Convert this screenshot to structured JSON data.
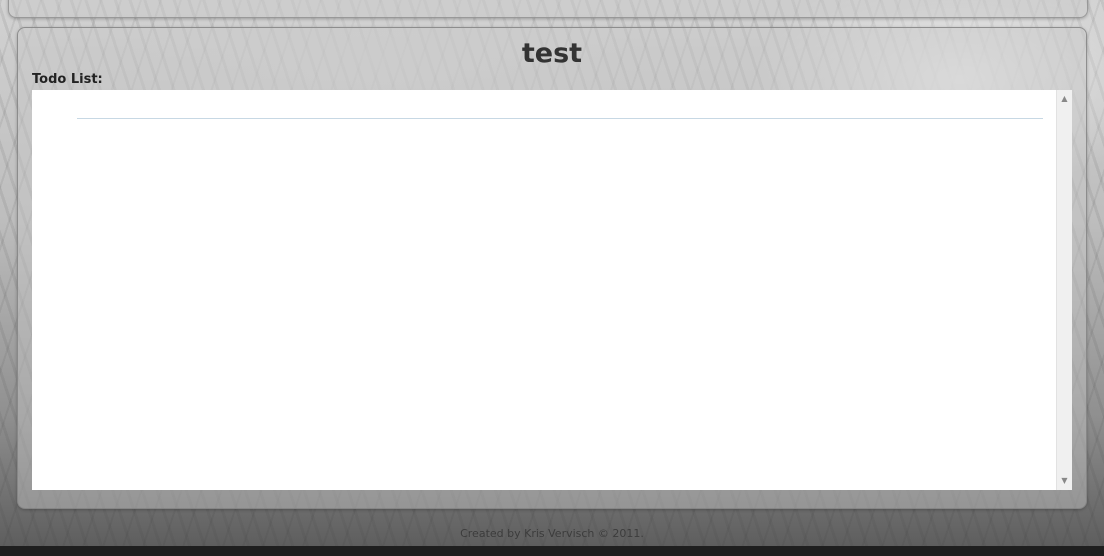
{
  "page": {
    "title": "test",
    "todo_label": "Todo List:"
  },
  "scrollbar": {
    "up_icon": "▲",
    "down_icon": "▼"
  },
  "footer": {
    "text": "Created by Kris Vervisch © 2011."
  },
  "colors": {
    "divider": "#c7d8e4",
    "title": "#333333"
  }
}
